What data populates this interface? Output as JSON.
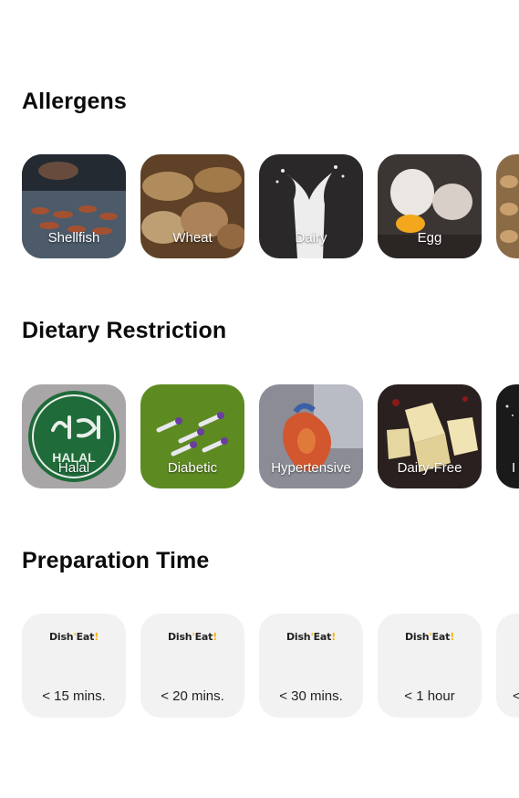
{
  "sections": {
    "allergens": {
      "title": "Allergens",
      "items": [
        {
          "label": "Shellfish",
          "icon": "shellfish-photo"
        },
        {
          "label": "Wheat",
          "icon": "wheat-bread-photo"
        },
        {
          "label": "Dairy",
          "icon": "milk-splash-photo"
        },
        {
          "label": "Egg",
          "icon": "egg-photo"
        },
        {
          "label": "",
          "icon": "peanut-photo"
        }
      ]
    },
    "dietary": {
      "title": "Dietary Restriction",
      "items": [
        {
          "label": "Halal",
          "icon": "halal-logo"
        },
        {
          "label": "Diabetic",
          "icon": "syringe-photo"
        },
        {
          "label": "Hypertensive",
          "icon": "heart-model-photo"
        },
        {
          "label": "Dairy-Free",
          "icon": "cheese-photo"
        },
        {
          "label": "I",
          "icon": "partial-photo"
        }
      ]
    },
    "prep_time": {
      "title": "Preparation Time",
      "logo": {
        "part1": "Dish",
        "dot": "'",
        "part2": "Eat",
        "bang": "!"
      },
      "items": [
        {
          "label": "< 15 mins."
        },
        {
          "label": "< 20 mins."
        },
        {
          "label": "< 30 mins."
        },
        {
          "label": "< 1 hour"
        },
        {
          "label": "<"
        }
      ]
    }
  },
  "colors": {
    "background": "#ffffff",
    "tile_gray": "#f2f2f2",
    "logo_accent": "#f5b400",
    "halal_green": "#1f6b3a",
    "diabetic_green": "#5e8a22"
  }
}
